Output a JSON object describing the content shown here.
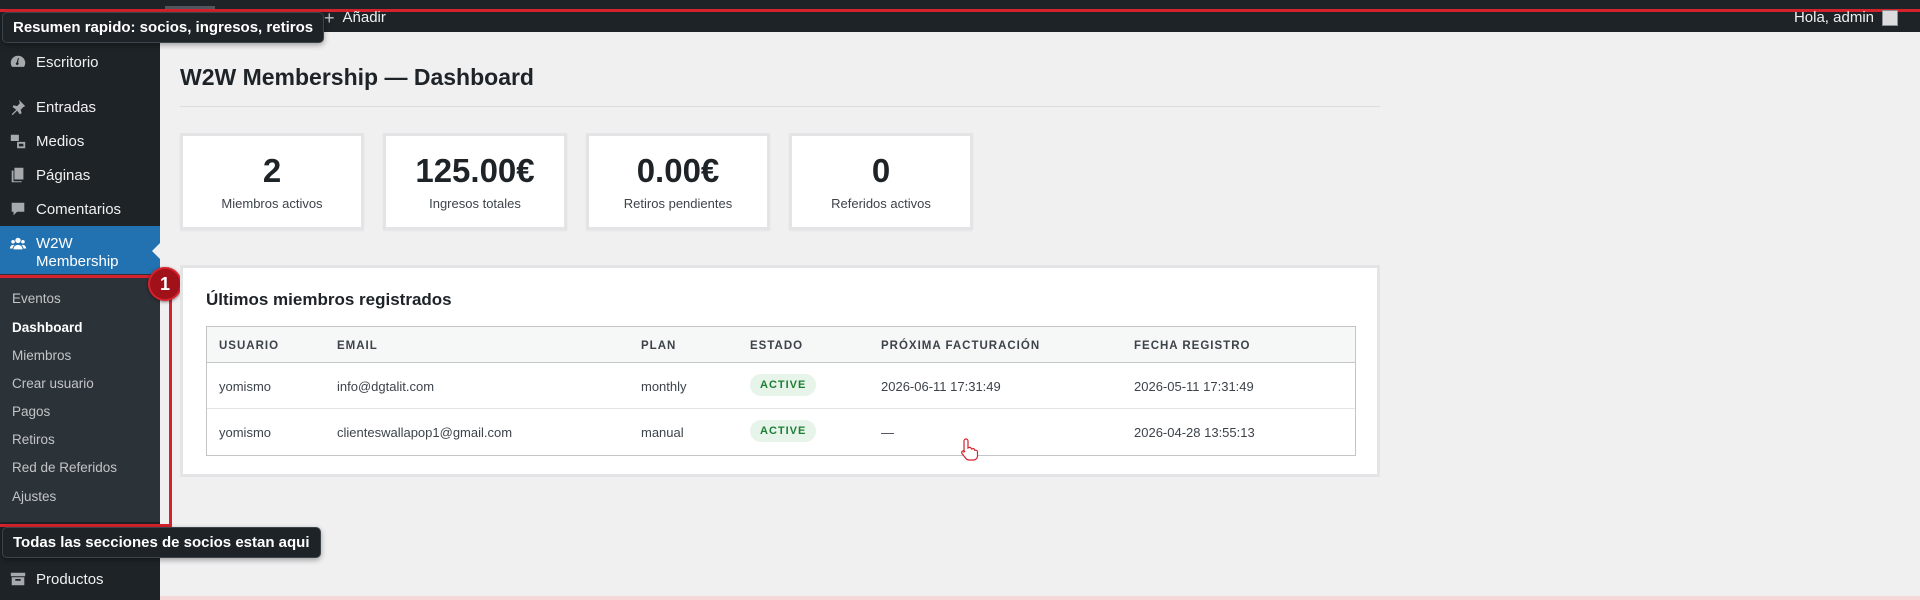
{
  "adminbar": {
    "add_label": "Añadir",
    "greeting": "Hola, admin"
  },
  "tooltips": {
    "top": "Resumen rapido: socios, ingresos, retiros",
    "bottom": "Todas las secciones de socios estan aqui"
  },
  "step_badge": "1",
  "sidebar": {
    "items": [
      {
        "label": "Escritorio",
        "icon": "dashboard-icon"
      },
      {
        "label": "Entradas",
        "icon": "pushpin-icon"
      },
      {
        "label": "Medios",
        "icon": "media-icon"
      },
      {
        "label": "Páginas",
        "icon": "pages-icon"
      },
      {
        "label": "Comentarios",
        "icon": "comment-icon"
      },
      {
        "label": "W2W",
        "label2": "Membership",
        "icon": "groups-icon"
      },
      {
        "label": "Productos",
        "icon": "archive-icon"
      }
    ],
    "submenu": [
      "Eventos",
      "Dashboard",
      "Miembros",
      "Crear usuario",
      "Pagos",
      "Retiros",
      "Red de Referidos",
      "Ajustes"
    ]
  },
  "main": {
    "title": "W2W Membership — Dashboard",
    "stats": [
      {
        "value": "2",
        "label": "Miembros activos"
      },
      {
        "value": "125.00€",
        "label": "Ingresos totales"
      },
      {
        "value": "0.00€",
        "label": "Retiros pendientes"
      },
      {
        "value": "0",
        "label": "Referidos activos"
      }
    ],
    "panel_title": "Últimos miembros registrados",
    "table": {
      "headers": [
        "USUARIO",
        "EMAIL",
        "PLAN",
        "ESTADO",
        "PRÓXIMA FACTURACIÓN",
        "FECHA REGISTRO"
      ],
      "rows": [
        [
          "yomismo",
          "info@dgtalit.com",
          "monthly",
          "ACTIVE",
          "2026-06-11 17:31:49",
          "2026-05-11 17:31:49"
        ],
        [
          "yomismo",
          "clienteswallapop1@gmail.com",
          "manual",
          "ACTIVE",
          "—",
          "2026-04-28 13:55:13"
        ]
      ]
    }
  },
  "colors": {
    "admin_bg": "#1d2327",
    "accent": "#2271b1",
    "highlight_red": "#d6222c",
    "status_green": "#1e7e34"
  }
}
